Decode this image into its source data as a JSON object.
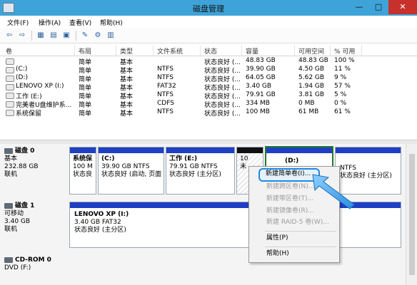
{
  "window": {
    "title": "磁盘管理",
    "btn_min": "—",
    "btn_max": "□",
    "btn_close": "✕"
  },
  "menu": [
    "文件(F)",
    "操作(A)",
    "查看(V)",
    "帮助(H)"
  ],
  "toolbar_icons": [
    "back-arrow-icon",
    "forward-arrow-icon",
    "grid-icon",
    "help-book-icon",
    "properties-icon",
    "help-icon",
    "view-icon"
  ],
  "volume_table": {
    "columns": [
      "卷",
      "布局",
      "类型",
      "文件系统",
      "状态",
      "容量",
      "可用空间",
      "% 可用"
    ],
    "rows": [
      [
        "",
        "简单",
        "基本",
        "",
        "状态良好 (...",
        "48.83 GB",
        "48.83 GB",
        "100 %"
      ],
      [
        "(C:)",
        "简单",
        "基本",
        "NTFS",
        "状态良好 (...",
        "39.90 GB",
        "4.50 GB",
        "11 %"
      ],
      [
        "(D:)",
        "简单",
        "基本",
        "NTFS",
        "状态良好 (...",
        "64.05 GB",
        "5.62 GB",
        "9 %"
      ],
      [
        "LENOVO XP (I:)",
        "简单",
        "基本",
        "FAT32",
        "状态良好 (...",
        "3.40 GB",
        "1.94 GB",
        "57 %"
      ],
      [
        "工作 (E:)",
        "简单",
        "基本",
        "NTFS",
        "状态良好 (...",
        "79.91 GB",
        "3.81 GB",
        "5 %"
      ],
      [
        "完美者U盘维护系...",
        "简单",
        "基本",
        "CDFS",
        "状态良好 (...",
        "334 MB",
        "0 MB",
        "0 %"
      ],
      [
        "系统保留",
        "简单",
        "基本",
        "NTFS",
        "状态良好 (...",
        "100 MB",
        "61 MB",
        "61 %"
      ]
    ]
  },
  "disks": [
    {
      "name": "磁盘 0",
      "type": "基本",
      "size": "232.88 GB",
      "status": "联机",
      "partitions": [
        {
          "line1": "系统保",
          "line2": "100 M",
          "line3": "状态良"
        },
        {
          "line1": "(C:)",
          "line2": "39.90 GB NTFS",
          "line3": "状态良好 (启动, 页面"
        },
        {
          "line1": "工作 (E:)",
          "line2": "79.91 GB NTFS",
          "line3": "状态良好 (主分区)"
        },
        {
          "line1": "",
          "line2": "10",
          "line3": "未"
        },
        {
          "line1": "(D:)",
          "line2": "",
          "line3": ""
        },
        {
          "line1": "",
          "line2": "NTFS",
          "line3": "状态良好 (主分区)"
        }
      ]
    },
    {
      "name": "磁盘 1",
      "type": "可移动",
      "size": "3.40 GB",
      "status": "联机",
      "partitions": [
        {
          "line1": "LENOVO XP  (I:)",
          "line2": "3.40 GB FAT32",
          "line3": "状态良好 (主分区)"
        }
      ]
    },
    {
      "name": "CD-ROM 0",
      "type": "DVD (F:)",
      "size": "",
      "status": "",
      "partitions": []
    }
  ],
  "context_menu": {
    "items": [
      {
        "label": "新建简单卷(I)...",
        "enabled": true
      },
      {
        "label": "新建跨区卷(N)...",
        "enabled": false
      },
      {
        "label": "新建带区卷(T)...",
        "enabled": false
      },
      {
        "label": "新建镜像卷(R)...",
        "enabled": false
      },
      {
        "label": "新建 RAID-5 卷(W)...",
        "enabled": false
      },
      {
        "label": "属性(P)",
        "enabled": true
      },
      {
        "label": "帮助(H)",
        "enabled": true
      }
    ]
  },
  "colors": {
    "titlebar": "#3ea3d8",
    "partition_bar": "#1f3fc4",
    "selection": "#1f7a2a",
    "highlight": "#1e88e5",
    "close": "#c7312b"
  }
}
